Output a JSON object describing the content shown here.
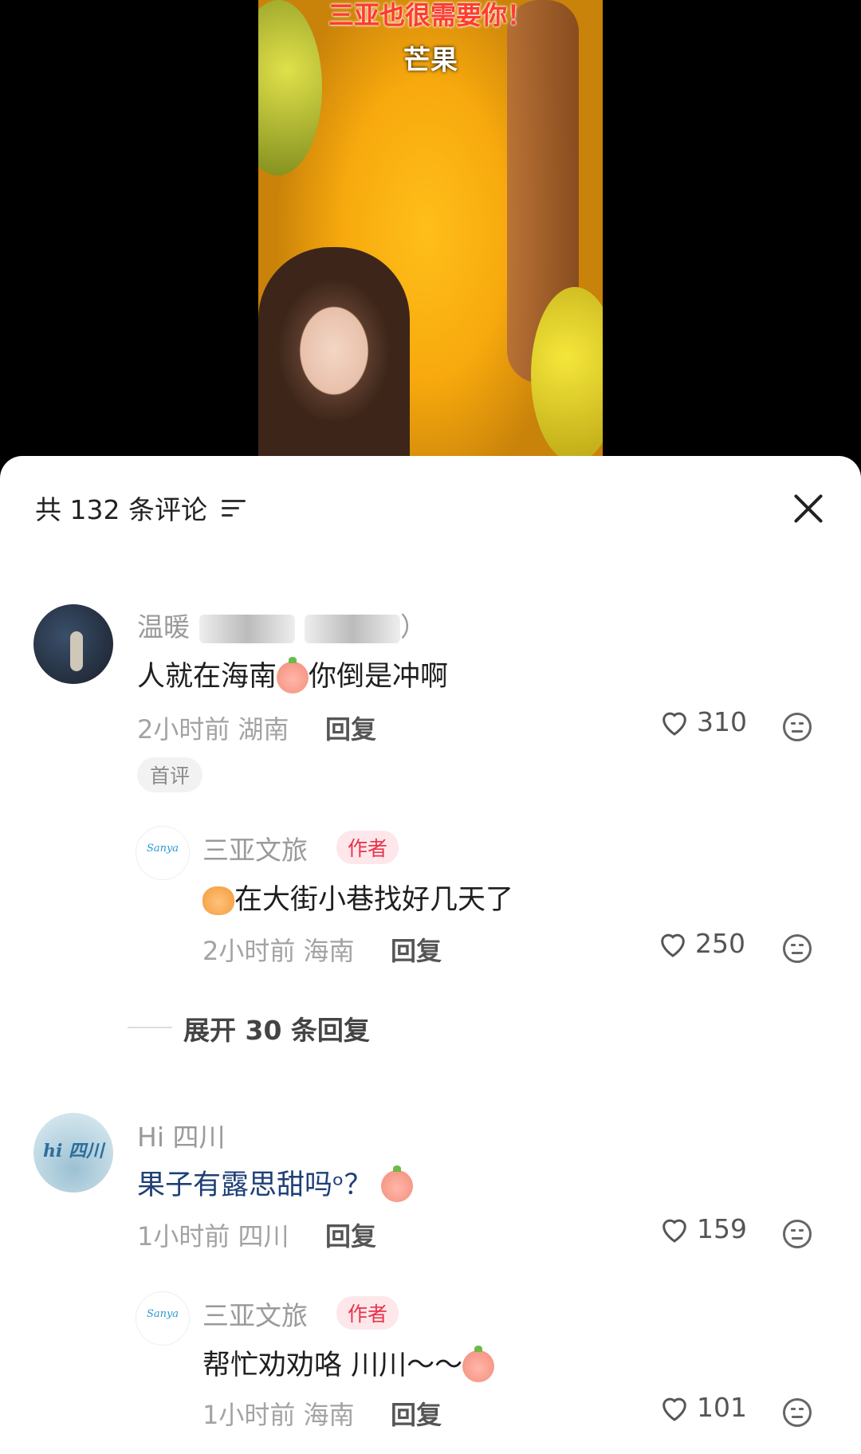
{
  "video": {
    "caption_top": "三亚也很需要你！",
    "caption_sub": "芒果"
  },
  "sheet": {
    "title": "共 132 条评论",
    "filter_icon": "filter-icon",
    "close_icon": "close-icon"
  },
  "comments": [
    {
      "username": "温暖",
      "username_tail": "）",
      "text_before": "人就在海南",
      "text_after": "你倒是冲啊",
      "time": "2小时前",
      "location": "湖南",
      "reply_label": "回复",
      "likes": "310",
      "badge": "首评",
      "replies": [
        {
          "username": "三亚文旅",
          "badge": "作者",
          "text": "在大街小巷找好几天了",
          "time": "2小时前",
          "location": "海南",
          "reply_label": "回复",
          "likes": "250"
        }
      ],
      "expand_label": "展开 30 条回复"
    },
    {
      "username": "Hi 四川",
      "text": "果子有露思甜吗ᵒ？",
      "time": "1小时前",
      "location": "四川",
      "reply_label": "回复",
      "likes": "159",
      "replies": [
        {
          "username": "三亚文旅",
          "badge": "作者",
          "text": "帮忙劝劝咯 川川～～",
          "time": "1小时前",
          "location": "海南",
          "reply_label": "回复",
          "likes": "101"
        }
      ]
    }
  ],
  "avatar_texts": {
    "sichuan": "hi 四川",
    "sanya": "Sanya"
  },
  "colors": {
    "author_badge": "#e8324a",
    "mango": "#f7a90d",
    "link": "#1f3f77"
  }
}
